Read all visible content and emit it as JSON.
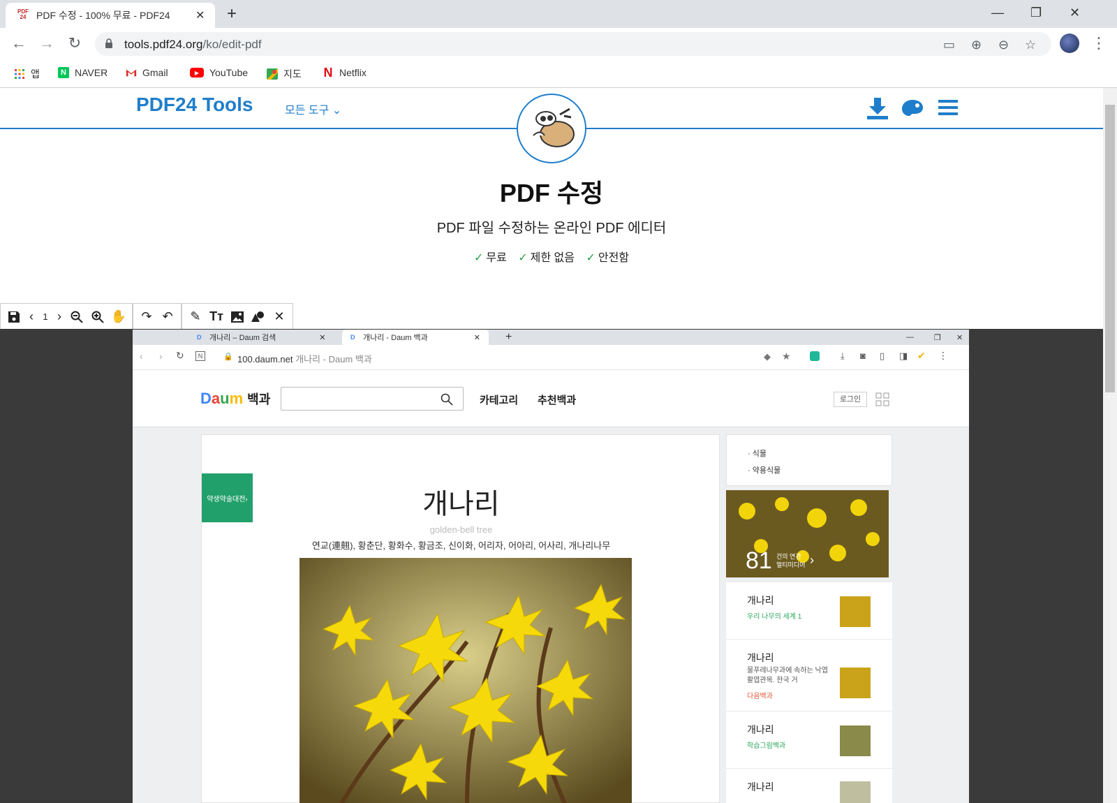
{
  "browser": {
    "tab_title": "PDF 수정 - 100% 무료 - PDF24",
    "tab_favicon_text": "PDF 24",
    "url_host": "tools.pdf24.org",
    "url_path": "/ko/edit-pdf"
  },
  "bookmarks": [
    {
      "label": "앱",
      "icon": "apps-grid-icon"
    },
    {
      "label": "NAVER",
      "icon": "naver-icon",
      "color": "#03c75a"
    },
    {
      "label": "Gmail",
      "icon": "gmail-icon",
      "color": "#d93025"
    },
    {
      "label": "YouTube",
      "icon": "youtube-icon",
      "color": "#ff0000"
    },
    {
      "label": "지도",
      "icon": "maps-icon"
    },
    {
      "label": "Netflix",
      "icon": "netflix-icon",
      "color": "#e50914"
    }
  ],
  "pdf24": {
    "brand": "PDF24 Tools",
    "all_tools": "모든 도구",
    "title": "PDF 수정",
    "subtitle": "PDF 파일 수정하는 온라인 PDF 에디터",
    "features": [
      "무료",
      "제한 없음",
      "안전함"
    ],
    "accent": "#1f7ecb"
  },
  "editor": {
    "page_number": "1"
  },
  "embedded": {
    "tabs": [
      "개나리 – Daum 검색",
      "개나리 - Daum 백과"
    ],
    "url_host": "100.daum.net",
    "url_title": "개나리 - Daum 백과",
    "site_section": "백과",
    "nav": [
      "카테고리",
      "추천백과"
    ],
    "login": "로그인",
    "badge": "약생약술대전›",
    "article_title": "개나리",
    "english_name": "golden-bell tree",
    "aliases": "연교(連翹), 황춘단, 황화수, 황금조, 신이화, 어리자, 어아리, 어사리, 개나리나무",
    "categories": [
      "식물",
      "약용식물"
    ],
    "media_count": "81",
    "media_label_1": "건의 연관",
    "media_label_2": "멀티미디어",
    "related": [
      {
        "title": "개나리",
        "source": "우리 나무의 세계 1"
      },
      {
        "title": "개나리",
        "desc": "물푸레나무과에 속하는 낙엽활엽관목. 한국 거",
        "source": "다음백과"
      },
      {
        "title": "개나리",
        "source": "학습그림백과"
      },
      {
        "title": "개나리"
      }
    ]
  }
}
